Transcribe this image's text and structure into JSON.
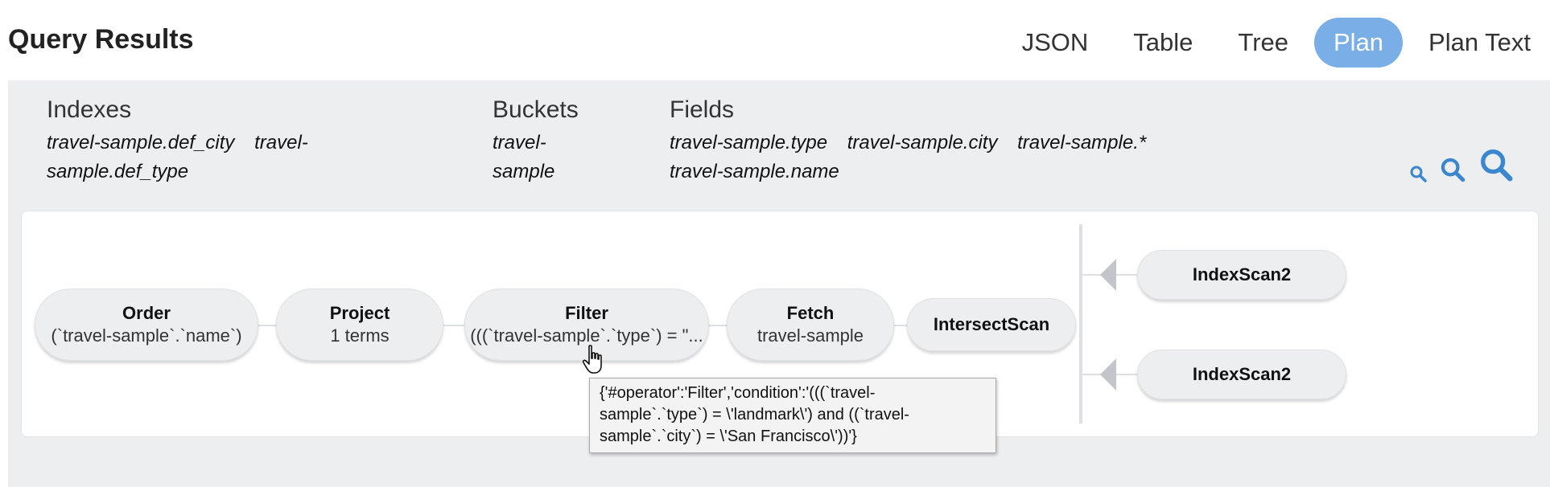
{
  "header": {
    "title": "Query Results",
    "tabs": [
      {
        "label": "JSON"
      },
      {
        "label": "Table"
      },
      {
        "label": "Tree"
      },
      {
        "label": "Plan",
        "active": true
      },
      {
        "label": "Plan Text"
      }
    ]
  },
  "meta": {
    "indexes": {
      "label": "Indexes",
      "values": [
        "travel-sample.def_city",
        "travel-sample.def_type"
      ]
    },
    "buckets": {
      "label": "Buckets",
      "values": [
        "travel-sample"
      ]
    },
    "fields": {
      "label": "Fields",
      "values": [
        "travel-sample.type",
        "travel-sample.city",
        "travel-sample.*",
        "travel-sample.name"
      ]
    }
  },
  "zoom": {
    "icons": [
      "zoom-small-icon",
      "zoom-medium-icon",
      "zoom-large-icon"
    ],
    "color": "#3a87cf"
  },
  "plan": {
    "nodes": [
      {
        "name": "Order",
        "detail": "(`travel-sample`.`name`)"
      },
      {
        "name": "Project",
        "detail": "1 terms"
      },
      {
        "name": "Filter",
        "detail": "(((`travel-sample`.`type`) = \"..."
      },
      {
        "name": "Fetch",
        "detail": "travel-sample"
      },
      {
        "name": "IntersectScan",
        "detail": ""
      },
      {
        "name": "IndexScan2",
        "detail": ""
      },
      {
        "name": "IndexScan2",
        "detail": ""
      }
    ]
  },
  "tooltip": {
    "lines": [
      "{'#operator':'Filter','condition':'(((`travel-",
      "sample`.`type`) = \\'landmark\\') and ((`travel-",
      "sample`.`city`) = \\'San Francisco\\'))'}"
    ]
  },
  "colors": {
    "accent": "#79aee6",
    "panel": "#eceef0",
    "node": "#eceef0"
  }
}
